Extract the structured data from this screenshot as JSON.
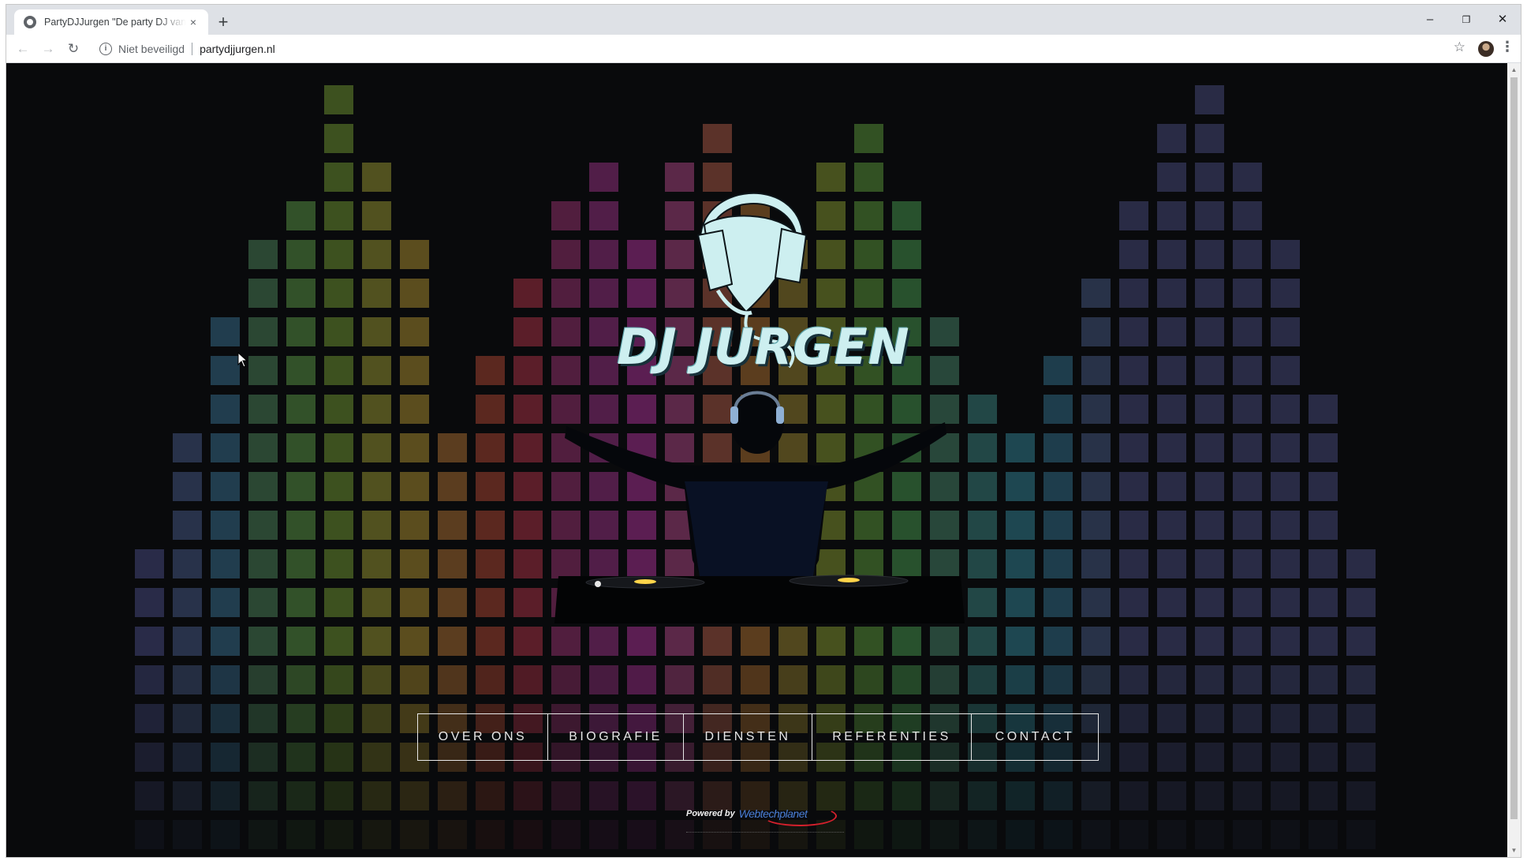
{
  "browser": {
    "tab_title": "PartyDJJurgen \"De party DJ van h",
    "tab_close": "×",
    "new_tab": "+",
    "minimize": "–",
    "restore": "❐",
    "close": "✕",
    "back": "←",
    "forward": "→",
    "reload": "↻",
    "info": "i",
    "security_label": "Niet beveiligd",
    "url": "partydjjurgen.nl",
    "bookmark": "☆",
    "menu": "⋮"
  },
  "hero": {
    "brand": "DJ JURGEN",
    "logo_color": "#cdeff0"
  },
  "nav": {
    "items": [
      {
        "label": "OVER ONS"
      },
      {
        "label": "BIOGRAFIE"
      },
      {
        "label": "DIENSTEN"
      },
      {
        "label": "REFERENTIES"
      },
      {
        "label": "CONTACT"
      }
    ]
  },
  "footer": {
    "powered_by": "Powered by",
    "powered_brand": "Webtechplanet"
  },
  "scrollbar": {
    "up": "▲",
    "down": "▼"
  }
}
